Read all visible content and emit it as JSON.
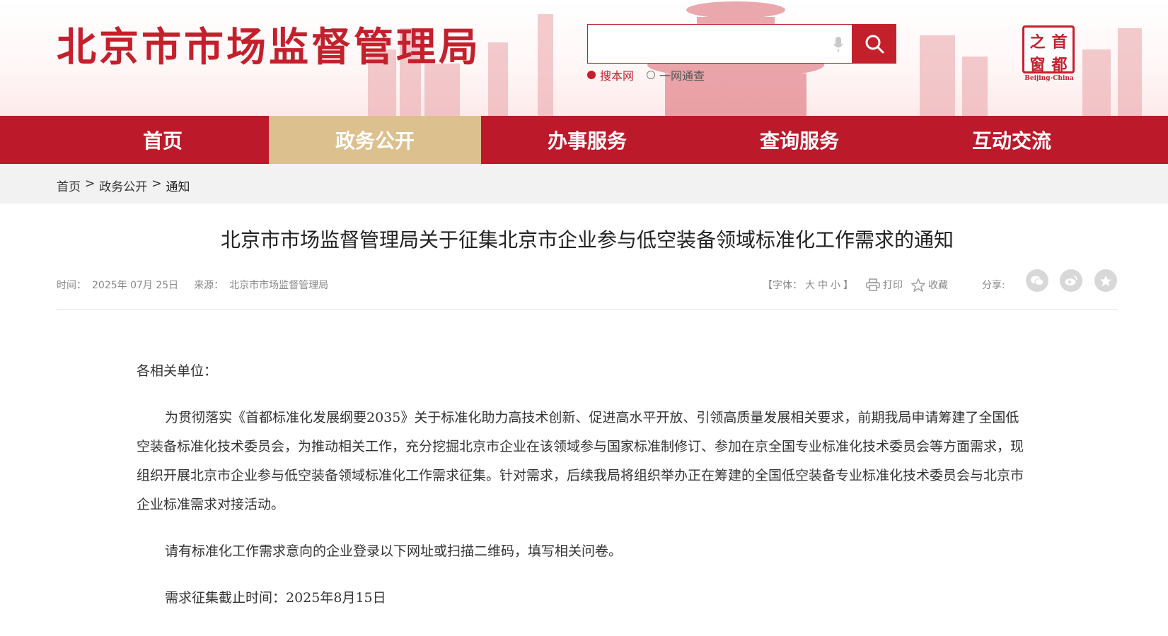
{
  "header": {
    "site_title": "北京市市场监督管理局",
    "search": {
      "placeholder": "",
      "option_site": "搜本网",
      "option_all": "一网通查"
    },
    "capital_logo": {
      "chars": [
        "之",
        "首",
        "窗",
        "都"
      ],
      "subtitle": "Beijing-China"
    }
  },
  "nav": {
    "items": [
      {
        "label": "首页"
      },
      {
        "label": "政务公开"
      },
      {
        "label": "办事服务"
      },
      {
        "label": "查询服务"
      },
      {
        "label": "互动交流"
      }
    ],
    "active_index": 1
  },
  "breadcrumb": {
    "home": "首页",
    "sep": ">",
    "section": "政务公开",
    "current": "通知"
  },
  "article": {
    "title": "北京市市场监督管理局关于征集北京市企业参与低空装备领域标准化工作需求的通知",
    "time_label": "时间：",
    "date": "2025年 07月 25日",
    "source_label": "来源：",
    "source": "北京市市场监督管理局",
    "font_label_open": "【字体：",
    "font_large": "大",
    "font_medium": "中",
    "font_small": "小",
    "font_label_close": "】",
    "print": "打印",
    "favorite": "收藏",
    "share_label": "分享:",
    "salutation": "各相关单位：",
    "paragraphs": [
      "为贯彻落实《首都标准化发展纲要2035》关于标准化助力高技术创新、促进高水平开放、引领高质量发展相关要求，前期我局申请筹建了全国低空装备标准化技术委员会，为推动相关工作，充分挖掘北京市企业在该领域参与国家标准制修订、参加在京全国专业标准化技术委员会等方面需求，现组织开展北京市企业参与低空装备领域标准化工作需求征集。针对需求，后续我局将组织举办正在筹建的全国低空装备专业标准化技术委员会与北京市企业标准需求对接活动。",
      "请有标准化工作需求意向的企业登录以下网址或扫描二维码，填写相关问卷。",
      "需求征集截止时间：2025年8月15日"
    ]
  },
  "colors": {
    "brand_red": "#bc1a2b",
    "active_tab": "#dcc08e",
    "breadcrumb_bg": "#f2f2f2"
  },
  "icons": [
    "search-icon",
    "mic-icon",
    "print-icon",
    "star-icon",
    "wechat-icon",
    "weibo-icon",
    "favorite-share-icon"
  ]
}
